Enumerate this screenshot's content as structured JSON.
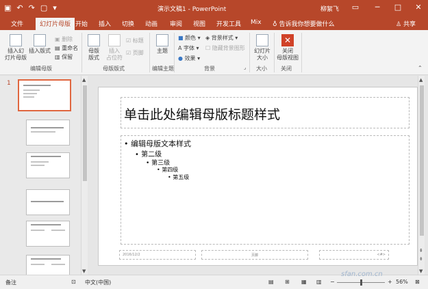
{
  "titlebar": {
    "title": "演示文稿1 - PowerPoint",
    "user": "柳絮飞",
    "quick_access": [
      "save-icon",
      "undo-icon",
      "redo-icon",
      "new-icon",
      "customize-icon"
    ],
    "window_buttons": [
      "ribbon-display-icon",
      "minimize-icon",
      "maximize-icon",
      "close-icon"
    ]
  },
  "menu": {
    "tabs": [
      "文件",
      "幻灯片母版",
      "开始",
      "插入",
      "切换",
      "动画",
      "审阅",
      "视图",
      "开发工具",
      "Mix"
    ],
    "active": "幻灯片母版",
    "tell_me": "告诉我你想要做什么",
    "share": "共享"
  },
  "ribbon": {
    "insert_master": "插入幻\n灯片母版",
    "insert_layout": "插入版式",
    "delete": "删除",
    "rename": "重命名",
    "preserve": "保留",
    "master_layout": "母版\n版式",
    "insert_placeholder": "插入\n占位符",
    "title_check": "标题",
    "footer_check": "页脚",
    "themes": "主题",
    "colors": "颜色",
    "fonts": "字体",
    "effects": "效果",
    "background_styles": "背景样式",
    "hide_bg_graphics": "隐藏背景图形",
    "slide_size": "幻灯片\n大小",
    "close_master": "关闭\n母版视图",
    "groups": {
      "edit_master": "编辑母版",
      "master_layout": "母版版式",
      "edit_theme": "编辑主题",
      "background": "背景",
      "size": "大小",
      "close": "关闭"
    }
  },
  "thumbnails": {
    "number": "1"
  },
  "slide": {
    "title": "单击此处编辑母版标题样式",
    "bullets": [
      "编辑母版文本样式",
      "第二级",
      "第三级",
      "第四级",
      "第五级"
    ],
    "date": "2016/12/2",
    "footer": "页脚",
    "slide_number": "<#>"
  },
  "status": {
    "notes_label": "备注",
    "language": "中文(中国)",
    "zoom": "56%"
  },
  "watermark": "sfan.com.cn"
}
